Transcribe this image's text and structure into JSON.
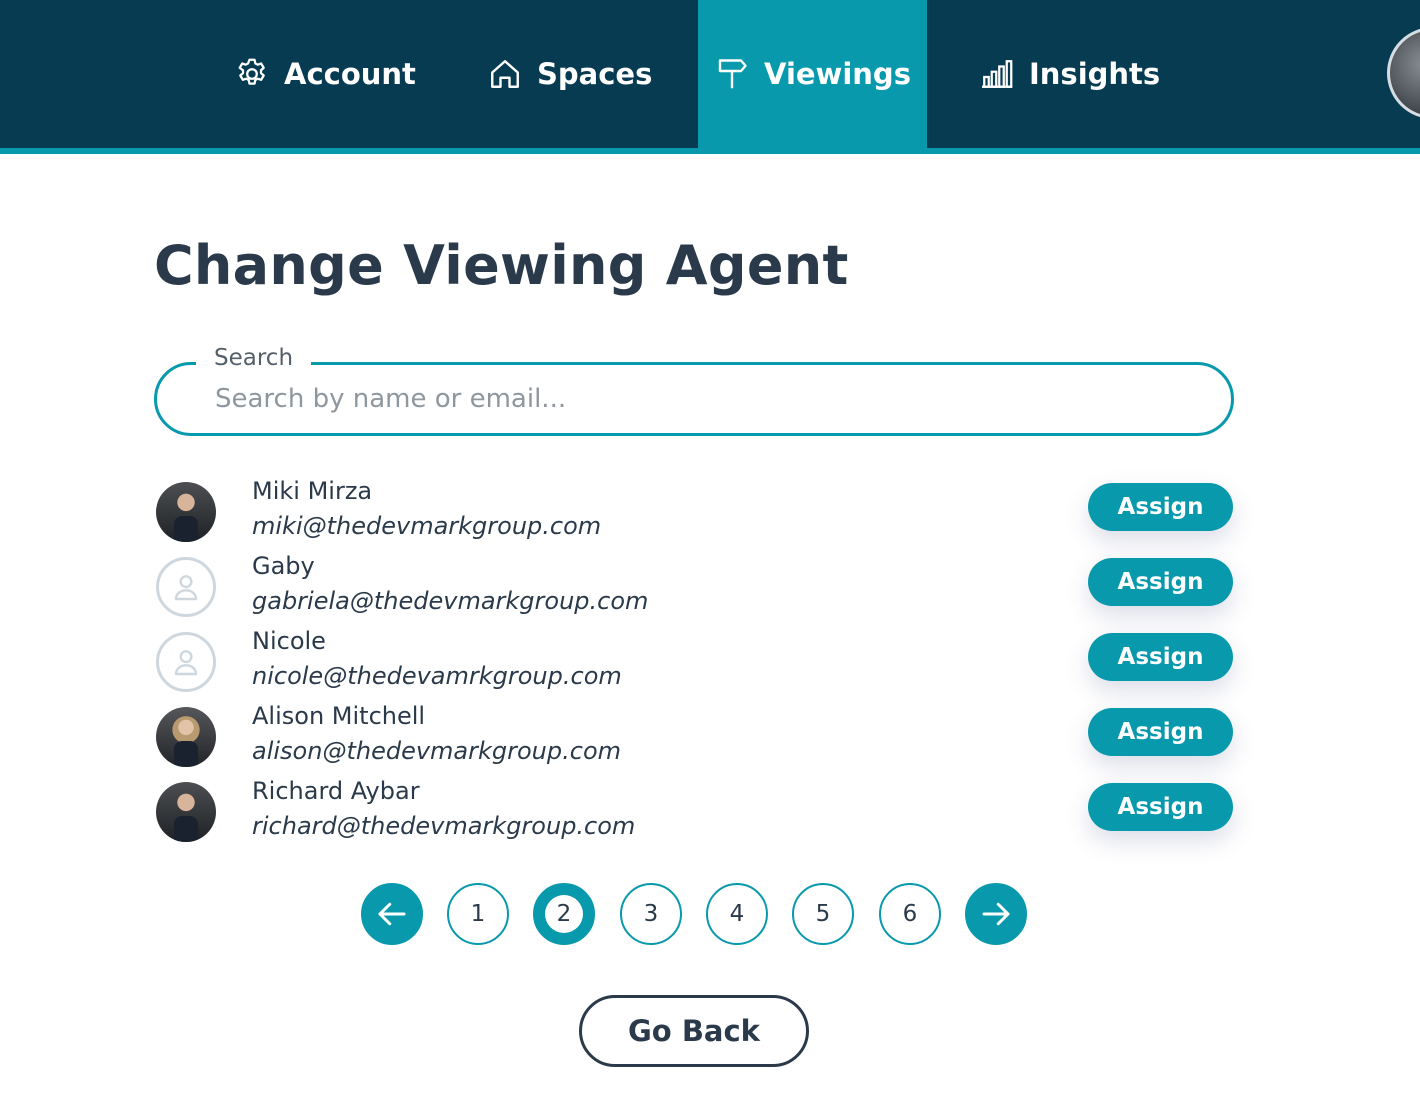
{
  "nav": {
    "items": [
      {
        "label": "Account",
        "icon": "gear-icon"
      },
      {
        "label": "Spaces",
        "icon": "home-icon"
      },
      {
        "label": "Viewings",
        "icon": "signpost-icon",
        "active": true
      },
      {
        "label": "Insights",
        "icon": "bar-chart-icon"
      }
    ]
  },
  "page": {
    "title": "Change Viewing Agent"
  },
  "search": {
    "label": "Search",
    "placeholder": "Search by name or email...",
    "value": ""
  },
  "agents": [
    {
      "name": "Miki Mirza",
      "email": "miki@thedevmarkgroup.com",
      "avatar": "photo",
      "action": "Assign"
    },
    {
      "name": "Gaby",
      "email": "gabriela@thedevmarkgroup.com",
      "avatar": "placeholder-user-icon",
      "action": "Assign"
    },
    {
      "name": "Nicole",
      "email": "nicole@thedevamrkgroup.com",
      "avatar": "placeholder-user-icon",
      "action": "Assign"
    },
    {
      "name": "Alison Mitchell",
      "email": "alison@thedevmarkgroup.com",
      "avatar": "photo",
      "action": "Assign"
    },
    {
      "name": "Richard Aybar",
      "email": "richard@thedevmarkgroup.com",
      "avatar": "photo",
      "action": "Assign"
    }
  ],
  "pagination": {
    "pages": [
      "1",
      "2",
      "3",
      "4",
      "5",
      "6"
    ],
    "current": "2",
    "prev_icon": "arrow-left-icon",
    "next_icon": "arrow-right-icon"
  },
  "actions": {
    "go_back_label": "Go Back"
  },
  "colors": {
    "nav_background": "#073b52",
    "accent": "#0899ad",
    "text": "#2b3a4a"
  }
}
